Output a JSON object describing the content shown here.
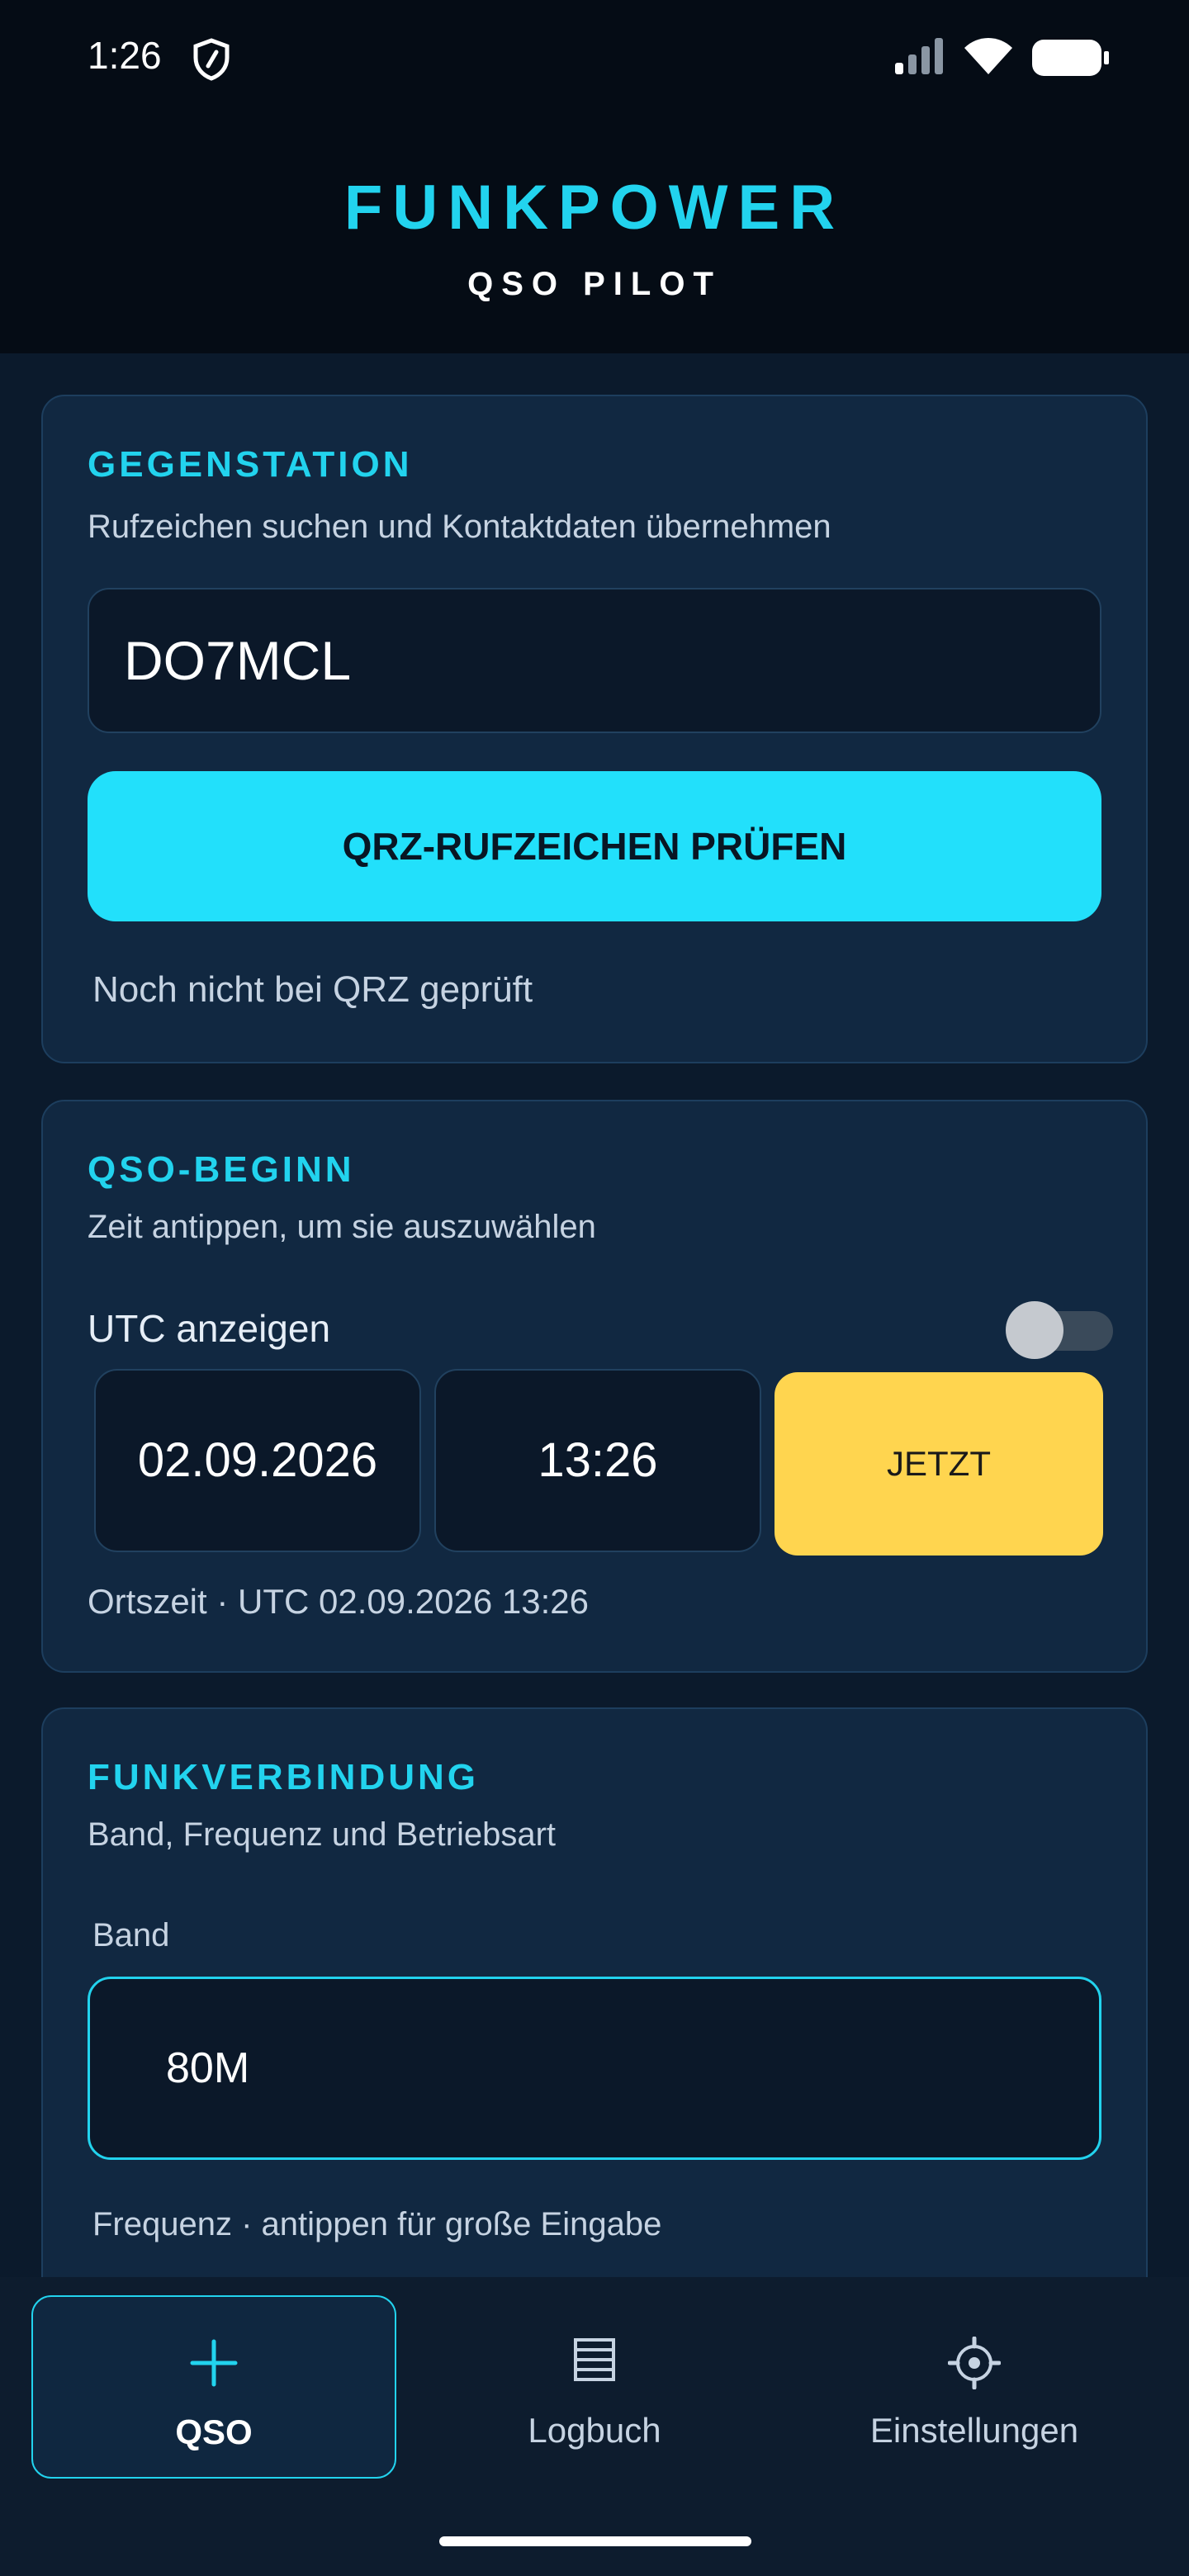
{
  "status_bar": {
    "time": "1:26",
    "icons": [
      "shield-icon",
      "signal-icon",
      "wifi-icon",
      "battery-icon"
    ]
  },
  "header": {
    "title": "FUNKPOWER",
    "subtitle": "QSO PILOT"
  },
  "gegenstation": {
    "title": "GEGENSTATION",
    "subtitle": "Rufzeichen suchen und Kontaktdaten übernehmen",
    "callsign_value": "DO7MCL",
    "check_button_label": "QRZ-RUFZEICHEN PRÜFEN",
    "status_text": "Noch nicht bei QRZ geprüft"
  },
  "qso_beginn": {
    "title": "QSO-BEGINN",
    "subtitle": "Zeit antippen, um sie auszuwählen",
    "utc_toggle_label": "UTC anzeigen",
    "utc_toggle_on": false,
    "date": "02.09.2026",
    "time": "13:26",
    "now_button_label": "JETZT",
    "time_note": "Ortszeit · UTC 02.09.2026 13:26"
  },
  "funkverbindung": {
    "title": "FUNKVERBINDUNG",
    "subtitle": "Band, Frequenz und Betriebsart",
    "band_label": "Band",
    "band_value": "80M",
    "frequency_label": "Frequenz · antippen für große Eingabe"
  },
  "bottom_nav": {
    "items": [
      {
        "label": "QSO",
        "icon": "plus-icon",
        "active": true
      },
      {
        "label": "Logbuch",
        "icon": "logbook-icon",
        "active": false
      },
      {
        "label": "Einstellungen",
        "icon": "settings-icon",
        "active": false
      }
    ]
  },
  "colors": {
    "accent": "#22d3ee",
    "now_button": "#ffd54f",
    "background": "#071220",
    "card": "#112841"
  }
}
